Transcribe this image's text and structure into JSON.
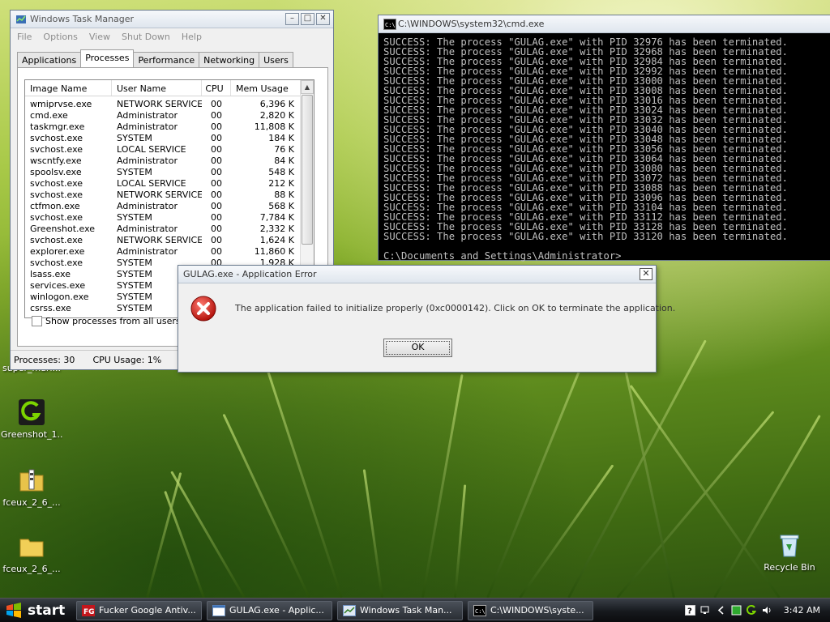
{
  "desktop": {
    "icons": [
      {
        "label": "super_mari...",
        "icon": "app-icon"
      },
      {
        "label": "Greenshot_1...",
        "icon": "greenshot-icon"
      },
      {
        "label": "fceux_2_6_...",
        "icon": "zip-folder-icon"
      },
      {
        "label": "fceux_2_6_...",
        "icon": "folder-icon"
      },
      {
        "label": "Recycle Bin",
        "icon": "recycle-bin-icon"
      }
    ]
  },
  "taskmgr": {
    "title": "Windows Task Manager",
    "menu": [
      "File",
      "Options",
      "View",
      "Shut Down",
      "Help"
    ],
    "tabs": [
      "Applications",
      "Processes",
      "Performance",
      "Networking",
      "Users"
    ],
    "active_tab": "Processes",
    "columns": [
      "Image Name",
      "User Name",
      "CPU",
      "Mem Usage"
    ],
    "rows": [
      [
        "wmiprvse.exe",
        "NETWORK SERVICE",
        "00",
        "6,396 K"
      ],
      [
        "cmd.exe",
        "Administrator",
        "00",
        "2,820 K"
      ],
      [
        "taskmgr.exe",
        "Administrator",
        "00",
        "11,808 K"
      ],
      [
        "svchost.exe",
        "SYSTEM",
        "00",
        "184 K"
      ],
      [
        "svchost.exe",
        "LOCAL SERVICE",
        "00",
        "76 K"
      ],
      [
        "wscntfy.exe",
        "Administrator",
        "00",
        "84 K"
      ],
      [
        "spoolsv.exe",
        "SYSTEM",
        "00",
        "548 K"
      ],
      [
        "svchost.exe",
        "LOCAL SERVICE",
        "00",
        "212 K"
      ],
      [
        "svchost.exe",
        "NETWORK SERVICE",
        "00",
        "88 K"
      ],
      [
        "ctfmon.exe",
        "Administrator",
        "00",
        "568 K"
      ],
      [
        "svchost.exe",
        "SYSTEM",
        "00",
        "7,784 K"
      ],
      [
        "Greenshot.exe",
        "Administrator",
        "00",
        "2,332 K"
      ],
      [
        "svchost.exe",
        "NETWORK SERVICE",
        "00",
        "1,624 K"
      ],
      [
        "explorer.exe",
        "Administrator",
        "00",
        "11,860 K"
      ],
      [
        "svchost.exe",
        "SYSTEM",
        "00",
        "1,928 K"
      ],
      [
        "lsass.exe",
        "SYSTEM",
        "00",
        ""
      ],
      [
        "services.exe",
        "SYSTEM",
        "00",
        ""
      ],
      [
        "winlogon.exe",
        "SYSTEM",
        "00",
        ""
      ],
      [
        "csrss.exe",
        "SYSTEM",
        "00",
        ""
      ]
    ],
    "show_all_label": "Show processes from all users",
    "status_processes": "Processes: 30",
    "status_cpu": "CPU Usage: 1%"
  },
  "cmd": {
    "title": "C:\\WINDOWS\\system32\\cmd.exe",
    "line_prefix": "SUCCESS: The process \"GULAG.exe\" with PID ",
    "line_suffix": " has been terminated.",
    "pids": [
      "32976",
      "32968",
      "32984",
      "32992",
      "33000",
      "33008",
      "33016",
      "33024",
      "33032",
      "33040",
      "33048",
      "33056",
      "33064",
      "33080",
      "33072",
      "33088",
      "33096",
      "33104",
      "33112",
      "33128",
      "33120"
    ],
    "prompt": "C:\\Documents and Settings\\Administrator>"
  },
  "error_dialog": {
    "title": "GULAG.exe - Application Error",
    "message": "The application failed to initialize properly (0xc0000142). Click on OK to terminate the application.",
    "ok_label": "OK",
    "close_label": "✕"
  },
  "taskbar": {
    "start_label": "start",
    "tasks": [
      {
        "label": "Fucker Google Antiv...",
        "icon": "fg-app-icon"
      },
      {
        "label": "GULAG.exe - Applic...",
        "icon": "window-icon"
      },
      {
        "label": "Windows Task Man...",
        "icon": "task-manager-icon"
      },
      {
        "label": "C:\\WINDOWS\\syste...",
        "icon": "cmd-icon"
      }
    ],
    "clock": "3:42 AM"
  },
  "colors": {
    "error_red": "#d4201a",
    "console_bg": "#000000",
    "console_fg": "#c0c0c0"
  }
}
